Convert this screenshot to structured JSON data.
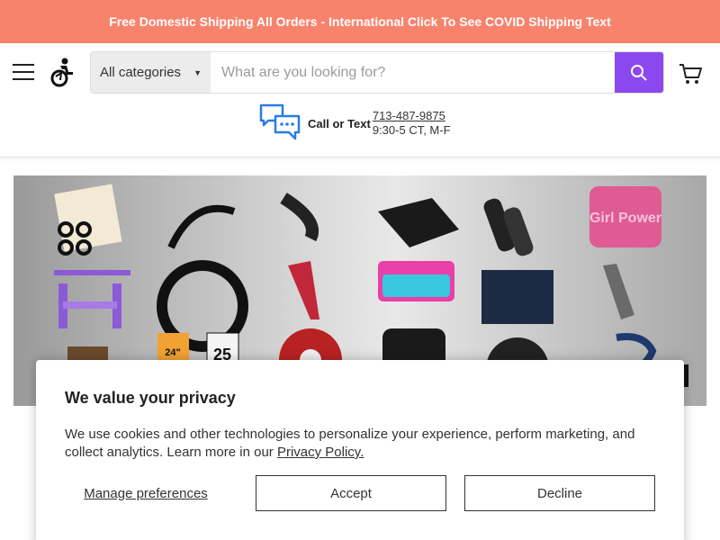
{
  "announcement": {
    "text": "Free Domestic Shipping All Orders - International Click To See COVID Shipping Text"
  },
  "header": {
    "menu_icon": "hamburger-menu-icon",
    "logo_icon": "wheelchair-logo-icon",
    "search": {
      "category_label": "All categories",
      "placeholder": "What are you looking for?",
      "button_icon": "search-icon"
    },
    "cart_icon": "cart-icon",
    "contact": {
      "icon": "chat-bubbles-icon",
      "label": "Call or Text",
      "phone": "713-487-9875",
      "hours": "9:30-5 CT, M-F"
    }
  },
  "hero": {
    "image_label": "Girl Power",
    "tire_label": "24\"",
    "tube_label": "25"
  },
  "cookie_modal": {
    "title": "We value your privacy",
    "text": "We use cookies and other technologies to personalize your experience, perform marketing, and collect analytics. Learn more in our",
    "link_label": "Privacy Policy.",
    "manage_label": "Manage preferences",
    "accept_label": "Accept",
    "decline_label": "Decline"
  },
  "colors": {
    "announcement_bg": "#f8836d",
    "accent": "#8b48ef",
    "icon_blue": "#2a7de1"
  }
}
